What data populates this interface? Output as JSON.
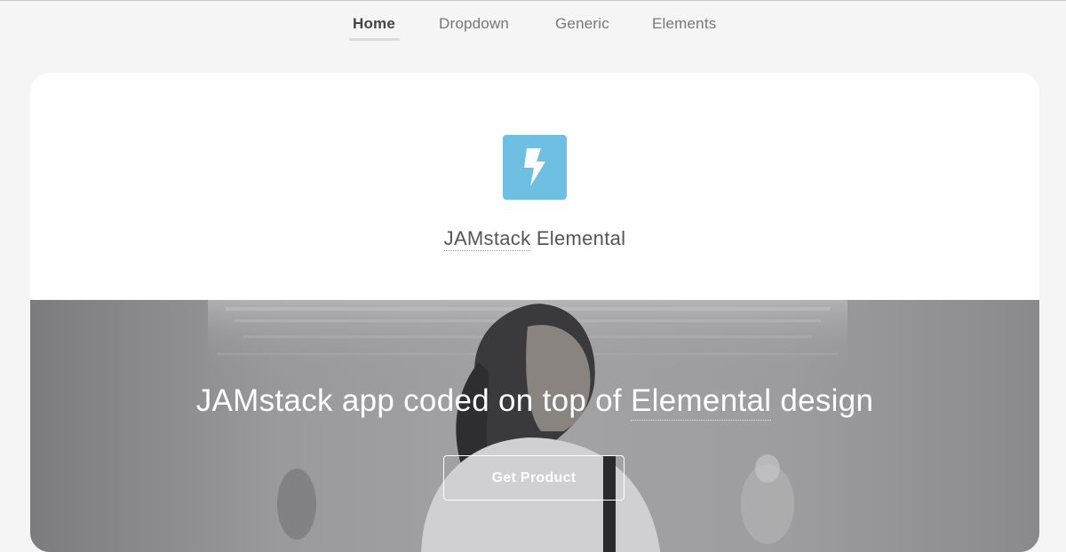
{
  "nav": {
    "items": [
      {
        "label": "Home",
        "active": true
      },
      {
        "label": "Dropdown",
        "active": false
      },
      {
        "label": "Generic",
        "active": false
      },
      {
        "label": "Elements",
        "active": false
      }
    ]
  },
  "logo": {
    "icon": "lightning-bolt-icon",
    "color": "#6fbfe3"
  },
  "site_title": {
    "abbr": "JAMstack",
    "rest": "Elemental"
  },
  "hero": {
    "heading_before": "JAMstack app coded on top of ",
    "heading_abbr": "Elemental",
    "heading_after": " design",
    "button_label": "Get Product"
  }
}
